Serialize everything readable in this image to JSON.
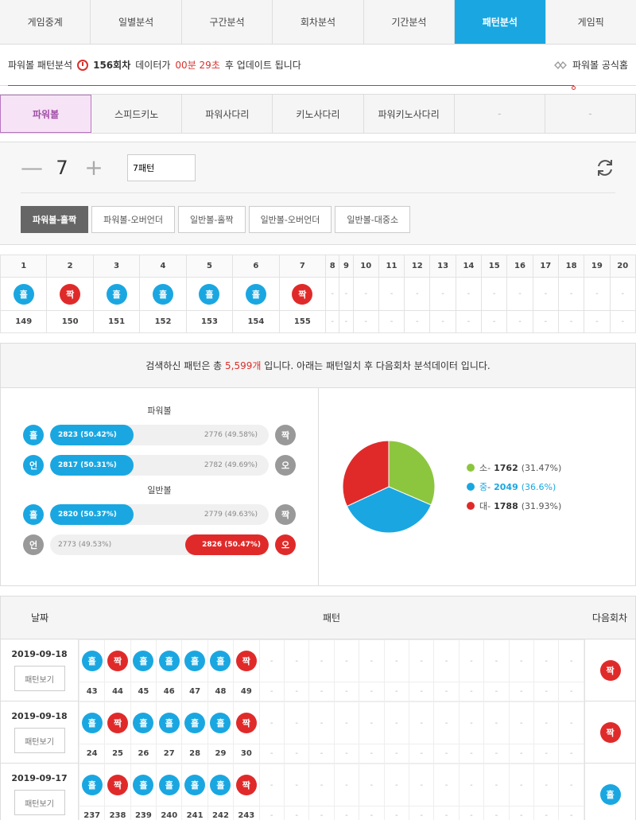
{
  "nav": [
    "게임중계",
    "일별분석",
    "구간분석",
    "회차분석",
    "기간분석",
    "패턴분석",
    "게임픽"
  ],
  "nav_active": 5,
  "info": {
    "prefix": "파워볼 패턴분석",
    "round": "156회차",
    "mid": "데이터가",
    "time": "00분 29초",
    "suffix": "후 업데이트 됩니다",
    "official": "파워볼 공식홈"
  },
  "game_tabs": [
    "파워볼",
    "스피드키노",
    "파워사다리",
    "키노사다리",
    "파워키노사다리",
    "-",
    "-"
  ],
  "control": {
    "minus": "—",
    "plus": "+",
    "count": "7",
    "pattern_input": "7패턴",
    "buttons": [
      "파워볼-홀짝",
      "파워볼-오버언더",
      "일반볼-홀짝",
      "일반볼-오버언더",
      "일반볼-대중소"
    ]
  },
  "pattern": {
    "positions": [
      "1",
      "2",
      "3",
      "4",
      "5",
      "6",
      "7",
      "8",
      "9",
      "10",
      "11",
      "12",
      "13",
      "14",
      "15",
      "16",
      "17",
      "18",
      "19",
      "20"
    ],
    "balls": [
      "홀",
      "짝",
      "홀",
      "홀",
      "홀",
      "홀",
      "짝",
      "-",
      "-",
      "-",
      "-",
      "-",
      "-",
      "-",
      "-",
      "-",
      "-",
      "-",
      "-",
      "-"
    ],
    "rounds": [
      "149",
      "150",
      "151",
      "152",
      "153",
      "154",
      "155",
      "-",
      "-",
      "-",
      "-",
      "-",
      "-",
      "-",
      "-",
      "-",
      "-",
      "-",
      "-",
      "-"
    ]
  },
  "stats": {
    "head_pre": "검색하신 패턴은 총",
    "head_count": "5,599개",
    "head_post": "입니다. 아래는 패턴일치 후 다음회차 분석데이터 입니다.",
    "powerball_title": "파워볼",
    "normal_title": "일반볼",
    "bars": [
      {
        "left": "홀",
        "right": "짝",
        "win": "2823 (50.42%)",
        "lose": "2776 (49.58%)",
        "pct": 50.42,
        "side": "left"
      },
      {
        "left": "언",
        "right": "오",
        "win": "2817 (50.31%)",
        "lose": "2782 (49.69%)",
        "pct": 50.31,
        "side": "left"
      },
      {
        "left": "홀",
        "right": "짝",
        "win": "2820 (50.37%)",
        "lose": "2779 (49.63%)",
        "pct": 50.37,
        "side": "left"
      },
      {
        "left": "언",
        "right": "오",
        "win": "2826 (50.47%)",
        "lose": "2773 (49.53%)",
        "pct": 50.47,
        "side": "right"
      }
    ],
    "pie": [
      {
        "label": "소",
        "count": "1762",
        "pct": "(31.47%)",
        "value": 31.47,
        "color": "#8cc63f"
      },
      {
        "label": "중",
        "count": "2049",
        "pct": "(36.6%)",
        "value": 36.6,
        "color": "#1aa7e1"
      },
      {
        "label": "대",
        "count": "1788",
        "pct": "(31.93%)",
        "value": 31.93,
        "color": "#e02a2a"
      }
    ]
  },
  "history": {
    "col_date": "날짜",
    "col_pattern": "패턴",
    "col_next": "다음회차",
    "view_label": "패턴보기",
    "rows": [
      {
        "date": "2019-09-18",
        "balls": [
          "홀",
          "짝",
          "홀",
          "홀",
          "홀",
          "홀",
          "짝"
        ],
        "rounds": [
          "43",
          "44",
          "45",
          "46",
          "47",
          "48",
          "49"
        ],
        "next": "짝"
      },
      {
        "date": "2019-09-18",
        "balls": [
          "홀",
          "짝",
          "홀",
          "홀",
          "홀",
          "홀",
          "짝"
        ],
        "rounds": [
          "24",
          "25",
          "26",
          "27",
          "28",
          "29",
          "30"
        ],
        "next": "짝"
      },
      {
        "date": "2019-09-17",
        "balls": [
          "홀",
          "짝",
          "홀",
          "홀",
          "홀",
          "홀",
          "짝"
        ],
        "rounds": [
          "237",
          "238",
          "239",
          "240",
          "241",
          "242",
          "243"
        ],
        "next": "홀"
      }
    ]
  },
  "colors": {
    "blue": "#1aa7e1",
    "red": "#e02a2a",
    "accent": "#a24ea8"
  }
}
